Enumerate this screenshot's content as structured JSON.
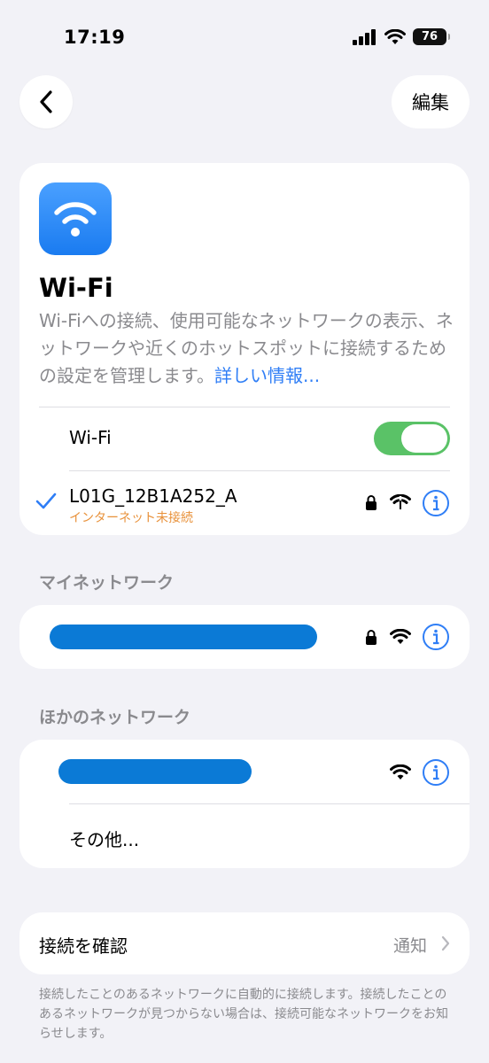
{
  "status": {
    "time": "17:19",
    "battery": "76"
  },
  "nav": {
    "back_icon": "chevron-left-icon",
    "edit_label": "編集"
  },
  "hero": {
    "title": "Wi-Fi",
    "description": "Wi-Fiへの接続、使用可能なネットワークの表示、ネットワークや近くのホットスポットに接続するための設定を管理します。",
    "link": "詳しい情報..."
  },
  "wifi_toggle": {
    "label": "Wi-Fi",
    "on": true
  },
  "current_network": {
    "name": "L01G_12B1A252_A",
    "status": "インターネット未接続"
  },
  "my_networks": {
    "header": "マイネットワーク"
  },
  "other_networks": {
    "header": "ほかのネットワーク",
    "other_label": "その他..."
  },
  "verify": {
    "label": "接続を確認",
    "value": "通知"
  },
  "footer_text": "接続したことのあるネットワークに自動的に接続します。接続したことのあるネットワークが見つからない場合は、接続可能なネットワークをお知らせします。",
  "colors": {
    "accent": "#2f7ef6",
    "toggle_on": "#5ac267",
    "warning": "#e8913a",
    "redaction": "#0b7ad6"
  }
}
